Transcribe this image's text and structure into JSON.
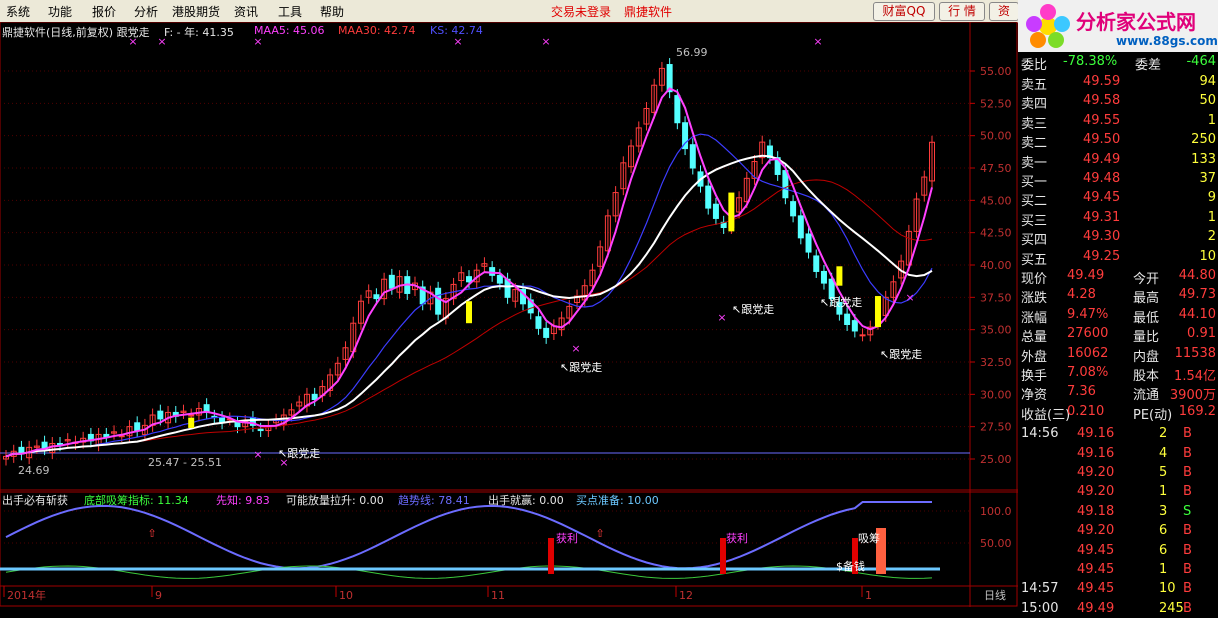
{
  "menu": {
    "items": [
      "系统",
      "功能",
      "报价",
      "分析",
      "港股期货",
      "资讯",
      "工具",
      "帮助"
    ],
    "status": "交易未登录",
    "brand": "鼎捷软件",
    "btn1": "财富QQ",
    "btn2": "行 情",
    "btn3": "资"
  },
  "logo": {
    "title": "分析家公式网",
    "url": "www.88gs.com"
  },
  "header": {
    "name": "鼎捷软件(日线,前复权) 跟党走",
    "f": "F: - 年: 41.35",
    "maa5": "MAA5: 45.06",
    "maa30": "MAA30: 42.74",
    "ks": "KS: 42.74"
  },
  "indicator": {
    "name": "出手必有斩获",
    "l1": "底部吸筹指标: 11.34",
    "l2": "先知: 9.83",
    "l3": "可能放量拉升: 0.00",
    "l4": "趋势线: 78.41",
    "l5": "出手就赢: 0.00",
    "l6": "买点准备: 10.00",
    "ticks": [
      "100.0",
      "50.00"
    ],
    "marks": [
      "获利",
      "获利",
      "吸筹",
      "$备钱"
    ]
  },
  "price_axis": [
    "55.00",
    "52.50",
    "50.00",
    "47.50",
    "45.00",
    "42.50",
    "40.00",
    "37.50",
    "35.00",
    "32.50",
    "30.00",
    "27.50",
    "25.00"
  ],
  "annotations": {
    "high": "56.99",
    "low": "25.47 - 25.51",
    "left": "24.69",
    "tag": "跟党走"
  },
  "x_axis": {
    "labels": [
      "2014年",
      "9",
      "10",
      "11",
      "12",
      "1"
    ],
    "right": "日线"
  },
  "colors": {
    "up": "#ff3c3c",
    "down": "#54ffff",
    "maa5": "#ff40ff",
    "maa30": "#ffffff",
    "ks": "#3c3cff",
    "ma": "#c00000"
  },
  "quote": {
    "wb": {
      "l1": "委比",
      "v1": "-78.38%",
      "l2": "委差",
      "v2": "-464"
    },
    "sells": [
      {
        "n": "卖五",
        "p": "49.59",
        "v": "94"
      },
      {
        "n": "卖四",
        "p": "49.58",
        "v": "50"
      },
      {
        "n": "卖三",
        "p": "49.55",
        "v": "1"
      },
      {
        "n": "卖二",
        "p": "49.50",
        "v": "250"
      },
      {
        "n": "卖一",
        "p": "49.49",
        "v": "133"
      }
    ],
    "buys": [
      {
        "n": "买一",
        "p": "49.48",
        "v": "37"
      },
      {
        "n": "买二",
        "p": "49.45",
        "v": "9"
      },
      {
        "n": "买三",
        "p": "49.31",
        "v": "1"
      },
      {
        "n": "买四",
        "p": "49.30",
        "v": "2"
      },
      {
        "n": "买五",
        "p": "49.25",
        "v": "10"
      }
    ],
    "stats": [
      {
        "a": "现价",
        "av": "49.49",
        "b": "今开",
        "bv": "44.80"
      },
      {
        "a": "涨跌",
        "av": "4.28",
        "b": "最高",
        "bv": "49.73"
      },
      {
        "a": "涨幅",
        "av": "9.47%",
        "b": "最低",
        "bv": "44.10"
      },
      {
        "a": "总量",
        "av": "27600",
        "b": "量比",
        "bv": "0.91"
      },
      {
        "a": "外盘",
        "av": "16062",
        "b": "内盘",
        "bv": "11538"
      },
      {
        "a": "换手",
        "av": "7.08%",
        "b": "股本",
        "bv": "1.54亿"
      },
      {
        "a": "净资",
        "av": "7.36",
        "b": "流通",
        "bv": "3900万"
      },
      {
        "a": "收益(三)",
        "av": "0.210",
        "b": "PE(动)",
        "bv": "169.2"
      }
    ],
    "ticks": [
      {
        "t": "14:56",
        "p": "49.16",
        "v": "2",
        "s": "B"
      },
      {
        "t": "",
        "p": "49.16",
        "v": "4",
        "s": "B"
      },
      {
        "t": "",
        "p": "49.20",
        "v": "5",
        "s": "B"
      },
      {
        "t": "",
        "p": "49.20",
        "v": "1",
        "s": "B"
      },
      {
        "t": "",
        "p": "49.18",
        "v": "3",
        "s": "S"
      },
      {
        "t": "",
        "p": "49.20",
        "v": "6",
        "s": "B"
      },
      {
        "t": "",
        "p": "49.45",
        "v": "6",
        "s": "B"
      },
      {
        "t": "",
        "p": "49.45",
        "v": "1",
        "s": "B"
      },
      {
        "t": "14:57",
        "p": "49.45",
        "v": "10",
        "s": "B"
      },
      {
        "t": "15:00",
        "p": "49.49",
        "v": "245",
        "s": "B"
      }
    ]
  }
}
